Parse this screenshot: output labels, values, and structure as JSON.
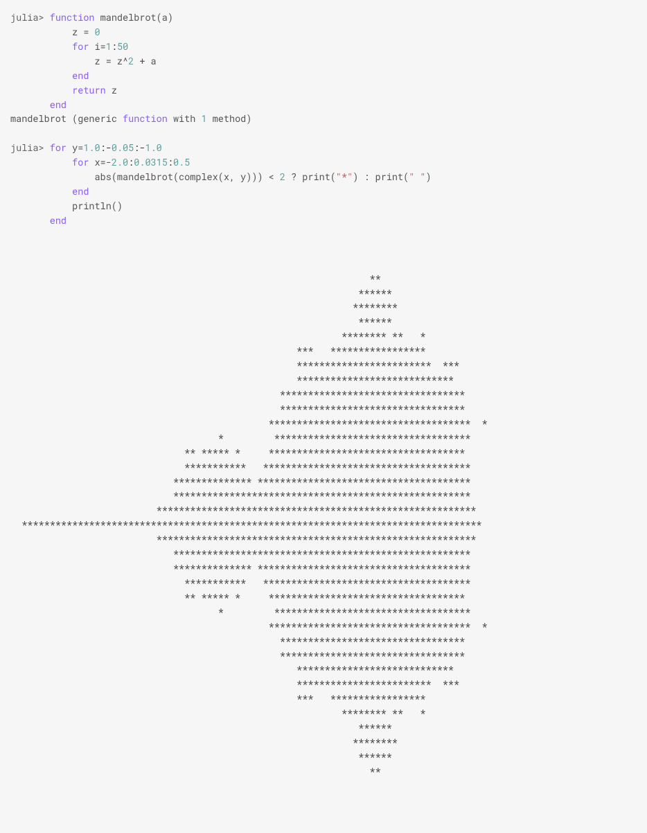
{
  "code": {
    "l1_prompt": "julia>",
    "l1_kw": "function",
    "l1_rest": " mandelbrot(a)",
    "l2": "           z = ",
    "l2_num": "0",
    "l3_pad": "           ",
    "l3_kw": "for",
    "l3_rest": " i=",
    "l3_num1": "1",
    "l3_colon": ":",
    "l3_num2": "50",
    "l4": "               z = z^",
    "l4_num": "2",
    "l4_rest": " + a",
    "l5_pad": "           ",
    "l5_kw": "end",
    "l6_pad": "           ",
    "l6_kw": "return",
    "l6_rest": " z",
    "l7_pad": "       ",
    "l7_kw": "end",
    "l8_a": "mandelbrot (generic ",
    "l8_kw": "function",
    "l8_b": " with ",
    "l8_num": "1",
    "l8_c": " method)",
    "blank": "",
    "l10_prompt": "julia>",
    "l10_kw": "for",
    "l10_rest": " y=",
    "l10_n1": "1.0",
    "l10_c1": ":-",
    "l10_n2": "0.05",
    "l10_c2": ":-",
    "l10_n3": "1.0",
    "l11_pad": "           ",
    "l11_kw": "for",
    "l11_rest": " x=-",
    "l11_n1": "2.0",
    "l11_c1": ":",
    "l11_n2": "0.0315",
    "l11_c2": ":",
    "l11_n3": "0.5",
    "l12_a": "               abs(mandelbrot(complex(x, y))) < ",
    "l12_num": "2",
    "l12_b": " ? print(",
    "l12_s1": "\"*\"",
    "l12_c": ") : print(",
    "l12_s2": "\" \"",
    "l12_d": ")",
    "l13_pad": "           ",
    "l13_kw": "end",
    "l14": "           println()",
    "l15_pad": "       ",
    "l15_kw": "end"
  },
  "output": [
    "                                                                                ",
    "                                                                                ",
    "                                                                                ",
    "                                                                **              ",
    "                                                              ******            ",
    "                                                             ********           ",
    "                                                              ******            ",
    "                                                           ******** **   *      ",
    "                                                   ***   *****************      ",
    "                                                   ************************  ***",
    "                                                   ****************************  ",
    "                                                *********************************",
    "                                                *********************************",
    "                                              ************************************  *",
    "                                     *         *********************************** ",
    "                               ** ***** *     ***********************************  ",
    "                               ***********   *************************************  ",
    "                             ************** **************************************   ",
    "                             *****************************************************   ",
    "                          *********************************************************     ",
    "  **********************************************************************************           ",
    "                          *********************************************************          ",
    "                             *****************************************************          ",
    "                             ************** **************************************          ",
    "                               ***********   *************************************         ",
    "                               ** ***** *     ***********************************         ",
    "                                     *         *********************************** ",
    "                                              ************************************  *",
    "                                                *********************************",
    "                                                *********************************",
    "                                                   ****************************  ",
    "                                                   ************************  ***",
    "                                                   ***   *****************      ",
    "                                                           ******** **   *      ",
    "                                                              ******            ",
    "                                                             ********           ",
    "                                                              ******            ",
    "                                                                **              ",
    "                                                                                ",
    "                                                                                ",
    "                                                                                "
  ]
}
